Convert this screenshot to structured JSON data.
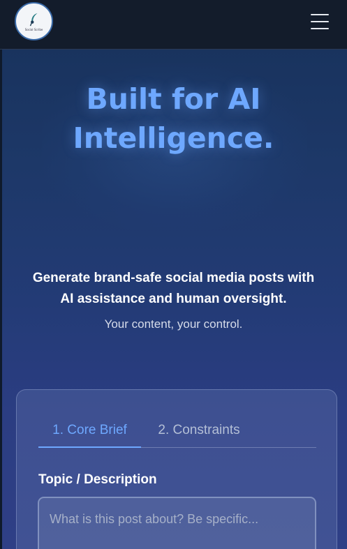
{
  "header": {
    "logo_text": "Social Scribe",
    "menu_icon": "hamburger-menu-icon"
  },
  "hero": {
    "title_line1": "Built for AI",
    "title_line2": "Intelligence.",
    "subtitle": "Generate brand-safe social media posts with AI assistance and human oversight.",
    "tagline": "Your content, your control."
  },
  "form": {
    "tabs": [
      {
        "label": "1. Core Brief",
        "active": true
      },
      {
        "label": "2. Constraints",
        "active": false
      }
    ],
    "topic_label": "Topic / Description",
    "topic_placeholder": "What is this post about? Be specific..."
  },
  "colors": {
    "accent": "#6ea8ff",
    "header_bg": "#131c2b"
  }
}
